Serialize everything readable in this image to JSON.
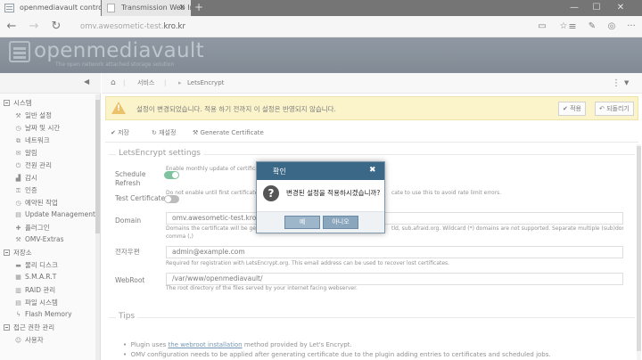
{
  "browser": {
    "tabs": [
      {
        "title": "openmediavault control",
        "icon": "omv-favicon",
        "active": true
      },
      {
        "title": "Transmission Web Interface",
        "icon": "page-icon",
        "active": false
      }
    ],
    "url_prefix": "omv.awesometic-test.",
    "url_domain": "kro.kr"
  },
  "header": {
    "logo_text": "openmediavault",
    "tagline": "The open network attached storage solution"
  },
  "sidebar": {
    "groups": [
      {
        "label": "시스템"
      },
      {
        "label": "저장소"
      },
      {
        "label": "접근 권한 관리"
      }
    ],
    "system_items": [
      "일반 설정",
      "날짜 및 시간",
      "네트워크",
      "알림",
      "전원 관리",
      "감시",
      "인증",
      "예약된 작업",
      "Update Management",
      "플러그인",
      "OMV-Extras"
    ],
    "storage_items": [
      "물리 디스크",
      "S.M.A.R.T",
      "RAID 관리",
      "파일 시스템",
      "Flash Memory"
    ],
    "access_items": [
      "사용자"
    ]
  },
  "breadcrumb": {
    "items": [
      "서비스",
      "LetsEncrypt"
    ]
  },
  "banner": {
    "text": "설정이 변경되었습니다. 적용 하기 전까지 이 설정은 반영되지 않습니다.",
    "apply": "적용",
    "revert": "되돌리기",
    "color": "#f9eeb0"
  },
  "toolbar": {
    "save": "저장",
    "reload": "재설정",
    "generate": "Generate Certificate"
  },
  "settings": {
    "title": "LetsEncrypt settings",
    "schedule_label_1": "Schedule",
    "schedule_label_2": "Refresh",
    "schedule_help": "Enable monthly update of certificate.",
    "schedule_on": true,
    "test_label": "Test Certificate",
    "test_help": "Do not enable until first certificate has been generated successfully. Use this to avoid rate limit errors.",
    "test_help_tail": "cate to use this to avoid rate limit errors.",
    "test_on": false,
    "domain_label": "Domain",
    "domain_value": "omv.awesometic-test.kro.kr",
    "domain_help_1": "Domains the certificate will be generated for. Separate multiple domains with a comma. Example: example.com, www.example.com, sub.afraid.org. Wildcard (*) domains are not supported. Separate multiple (sub)domains with a",
    "domain_help_2": "comma (,)",
    "email_label": "전자우편",
    "email_value": "admin@example.com",
    "email_help": "Required for registration with LetsEncrypt.org. This email address can be used to recover lost certificates.",
    "webroot_label": "WebRoot",
    "webroot_value": "/var/www/openmediavault/",
    "webroot_help": "The root directory of the files served by your internet facing webserver."
  },
  "tips": {
    "title": "Tips",
    "line1_pre": "Plugin uses ",
    "line1_link": "the webroot installation",
    "line1_post": " method provided by Let's Encrypt.",
    "line2": "OMV configuration needs to be applied after generating certificate due to the plugin adding entries to certificates and scheduled jobs."
  },
  "dialog": {
    "title": "확인",
    "message": "변경된 설정을 적용하시겠습니까?",
    "yes": "예",
    "no": "아니오",
    "header_color": "#3b6887"
  }
}
